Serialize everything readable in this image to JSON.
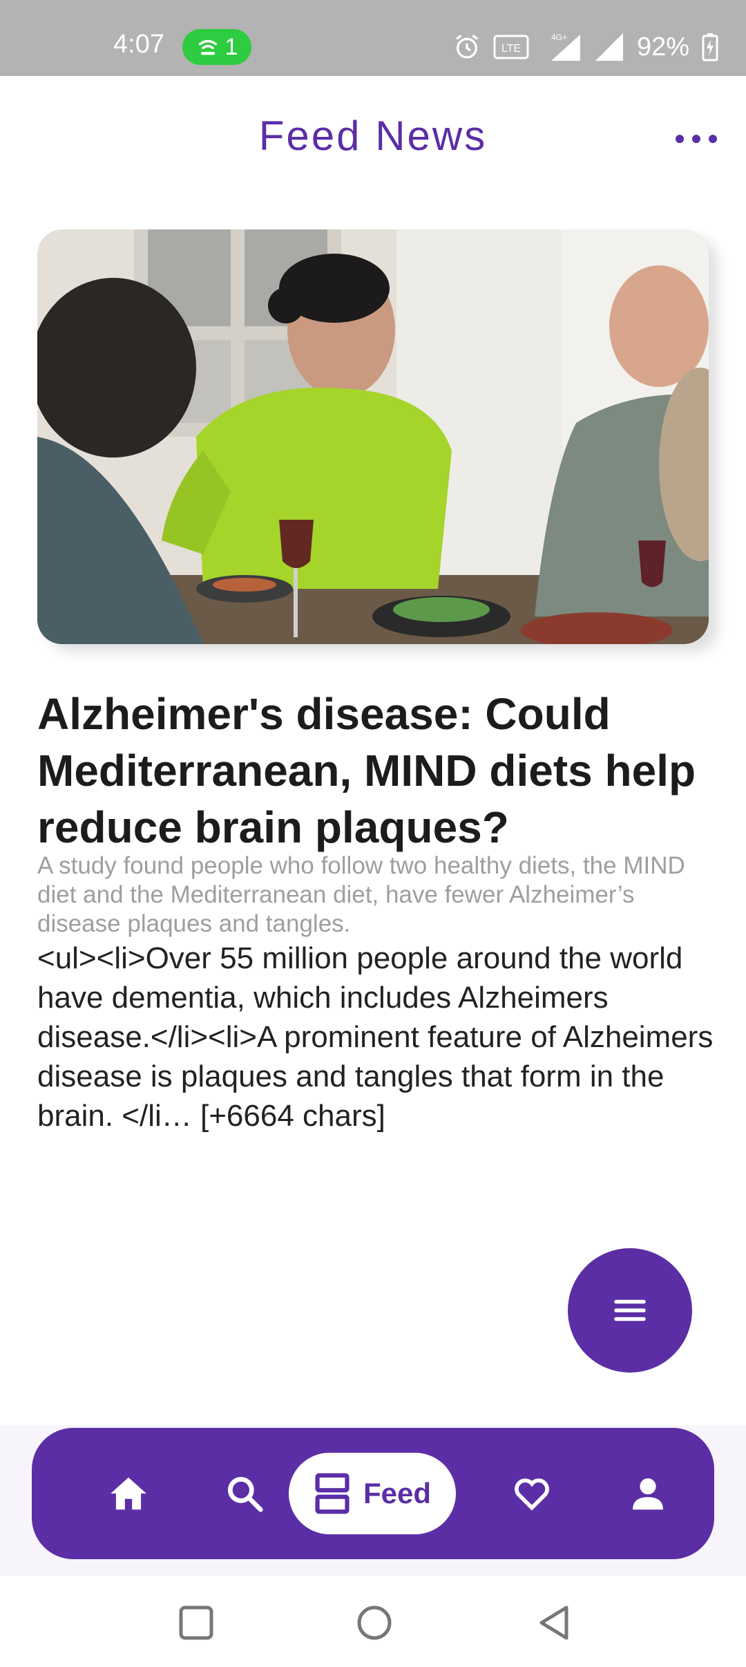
{
  "status_bar": {
    "time": "4:07",
    "hotspot_count": "1",
    "network_label": "4G+",
    "battery": "92%"
  },
  "header": {
    "title": "Feed News",
    "more_icon": "more-horizontal-icon"
  },
  "article": {
    "image_alt": "People laughing around a dinner table",
    "title": "Alzheimer's disease: Could Mediterranean, MIND diets help reduce brain plaques?",
    "summary": "A study found people who follow two healthy diets, the MIND diet and the Mediterranean diet, have fewer Alzheimer’s disease plaques and tangles.",
    "content": "<ul><li>Over 55 million people around the world have dementia, which includes Alzheimers disease.</li><li>A prominent feature of Alzheimers disease is plaques and tangles that form in the brain. </li… [+6664 chars]"
  },
  "fab": {
    "icon": "menu-icon"
  },
  "bottom_nav": {
    "items": [
      {
        "icon": "home-icon"
      },
      {
        "icon": "search-icon"
      },
      {
        "icon": "feed-icon",
        "label": "Feed",
        "active": true
      },
      {
        "icon": "heart-icon"
      },
      {
        "icon": "person-icon"
      }
    ]
  },
  "colors": {
    "accent": "#5b2ea6",
    "status_bar": "#b3b3b3",
    "hotspot_green": "#2ecc40"
  }
}
